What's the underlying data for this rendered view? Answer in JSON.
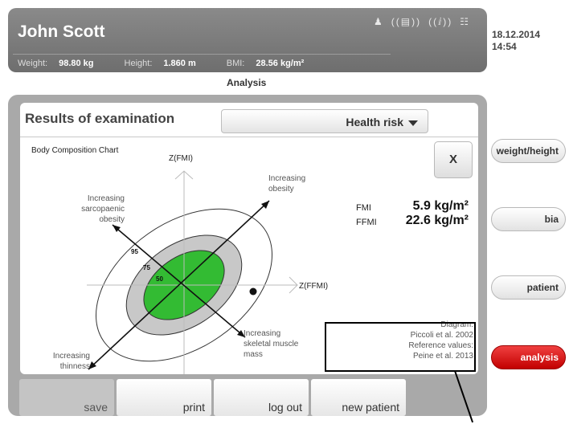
{
  "header": {
    "patient_name": "John Scott",
    "status_icons": [
      "person-icon",
      "scale-signal-icon",
      "wireless-signal-icon",
      "network-icon"
    ],
    "weight_label": "Weight:",
    "weight_value": "98.80 kg",
    "height_label": "Height:",
    "height_value": "1.860 m",
    "bmi_label": "BMI:",
    "bmi_value": "28.56 kg/m²",
    "date": "18.12.2014",
    "time": "14:54"
  },
  "page_title": "Analysis",
  "results": {
    "title": "Results of examination",
    "dropdown_value": "Health risk",
    "close_label": "X"
  },
  "chart": {
    "caption": "Body Composition Chart",
    "y_axis_label": "Z(FMI)",
    "x_axis_label": "Z(FFMI)",
    "annotations": {
      "obesity": [
        "Increasing",
        "obesity"
      ],
      "sarcopenic": [
        "Increasing",
        "sarcopaenic",
        "obesity"
      ],
      "muscle": [
        "Increasing",
        "skeletal muscle",
        "mass"
      ],
      "thinness": [
        "Increasing",
        "thinness"
      ]
    },
    "percentile_labels": [
      "95",
      "75",
      "50"
    ],
    "colors": {
      "inner": "#33bb33",
      "middle": "#c8c8c8",
      "outer": "#ffffff"
    }
  },
  "metrics": {
    "fmi_label": "FMI",
    "fmi_value": "5.9 kg/m²",
    "ffmi_label": "FFMI",
    "ffmi_value": "22.6 kg/m²"
  },
  "source": {
    "line1": "Diagram:",
    "line2": "Piccoli et al. 2002",
    "line3": "Reference values:",
    "line4": "Peine et al. 2013"
  },
  "buttons": {
    "save": "save",
    "print": "print",
    "logout": "log out",
    "new_patient": "new patient"
  },
  "side_nav": {
    "weight_height": "weight/height",
    "bia": "bia",
    "patient": "patient",
    "analysis": "analysis"
  },
  "accent_color": "#d40000"
}
